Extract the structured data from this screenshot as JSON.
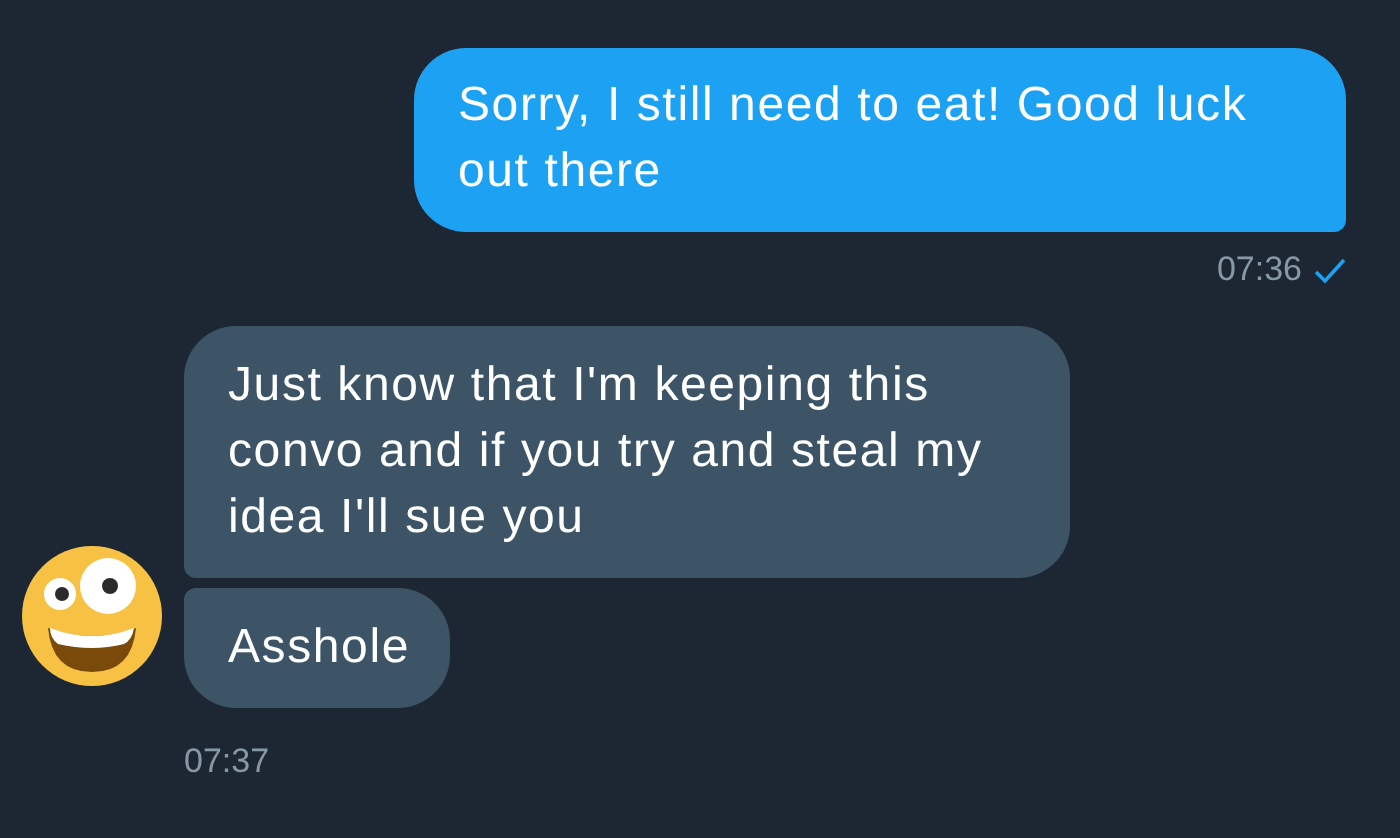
{
  "messages": [
    {
      "kind": "outgoing",
      "bubbles": [
        "Sorry, I still need to eat! Good luck out there"
      ],
      "time": "07:36",
      "read": true
    },
    {
      "kind": "incoming",
      "bubbles": [
        "Just know that I'm keeping this convo and if you try and steal my idea I'll sue you",
        "Asshole"
      ],
      "time": "07:37"
    }
  ]
}
